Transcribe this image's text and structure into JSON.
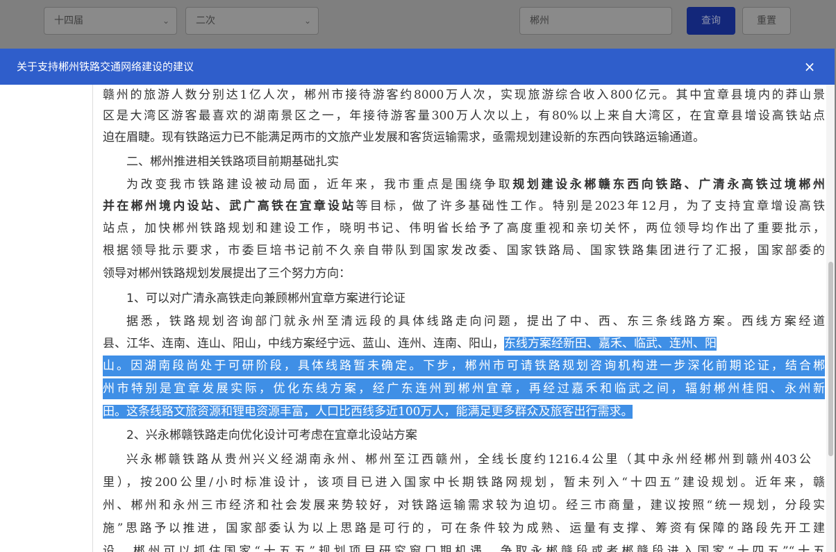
{
  "filters": {
    "session": "十四届",
    "meeting": "二次",
    "keyword": "郴州",
    "query_label": "查询",
    "reset_label": "重置"
  },
  "modal": {
    "title": "关于支持郴州铁路交通网络建设的建议",
    "close_glyph": "×"
  },
  "article": {
    "l1": "赣州的旅游人数分别达1亿人次，郴州市接待游客约8000万人次，实现旅游综合收入800亿元。其中宜章县境内的莽山景",
    "l2": "区是大湾区游客最喜欢的湖南景区之一，年接待游客量300万人次以上，有80%以上来自大湾区，在宜章县增设高铁站点",
    "l3": "迫在眉睫。现有铁路运力已不能满足两市的文旅产业发展和客货运输需求，亟需规划建设新的东西向铁路运输通道。",
    "h2": "二、郴州推进相关铁路项目前期基础扎实",
    "l5a": "为改变我市铁路建设被动局面，近年来，我市重点是围绕争取",
    "l5b": "规划建设永郴赣东西向铁路、广清永高铁过境郴州",
    "l6a": "并在郴州境内设站、武广高铁在宜章设站",
    "l6b": "等目标，做了许多基础性工作。特别是2023年12月，为了支持宜章增设高铁",
    "l7": "站点，加快郴州铁路规划和建设工作，晓明书记、伟明省长给予了高度重视和亲切关怀，两位领导均作出了重要批示，",
    "l8": "根据领导批示要求，市委巨培书记前不久亲自带队到国家发改委、国家铁路局、国家铁路集团进行了汇报，国家部委的",
    "l9": "领导对郴州铁路规划发展提出了三个努力方向：",
    "h3": "1、可以对广清永高铁走向兼顾郴州宜章方案进行论证",
    "l11": "据悉，铁路规划咨询部门就永州至清远段的具体线路走向问题，提出了中、西、东三条线路方案。西线方案经道",
    "l12a": "县、江华、连南、连山、阳山，中线方案经宁远、蓝山、连州、连南、阳山，",
    "l12b": "东线方案经新田、嘉禾、临武、连州、阳",
    "l13": "山。因湖南段尚处于可研阶段，具体线路暂未确定。下步，郴州市可请铁路规划咨询机构进一步深化前期论证，结合郴",
    "l14": "州市特别是宜章发展实际，优化东线方案，经广东连州到郴州宜章，再经过嘉禾和临武之间，辐射郴州桂阳、永州新",
    "l15": "田。这条线路文旅资源和锂电资源丰富，人口比西线多近100万人，能满足更多群众及旅客出行需求。",
    "h4": "2、兴永郴赣铁路走向优化设计可考虑在宜章北设站方案",
    "l17": "兴永郴赣铁路从贵州兴义经湖南永州、郴州至江西赣州，全线长度约1216.4公里（其中永州经郴州到赣州403公",
    "l18": "里），按200公里/小时标准设计，该项目已进入国家中长期铁路网规划，暂未列入“十四五”建设规划。近年来，赣",
    "l19": "州、郴州和永州三市经济和社会发展来势较好，对铁路运输需求较为迫切。经三市商量，建议按照“统一规划，分段实",
    "l20": "施”思路予以推进，国家部委认为以上思路是可行的，可在条件较为成熟、运量有支撑、筹资有保障的路段先开工建",
    "l21": "设。郴州可以抓住国家“十五五”规划项目研究窗口期机遇，争取永郴赣段或者郴赣段进入国家“十四五”“十五"
  }
}
